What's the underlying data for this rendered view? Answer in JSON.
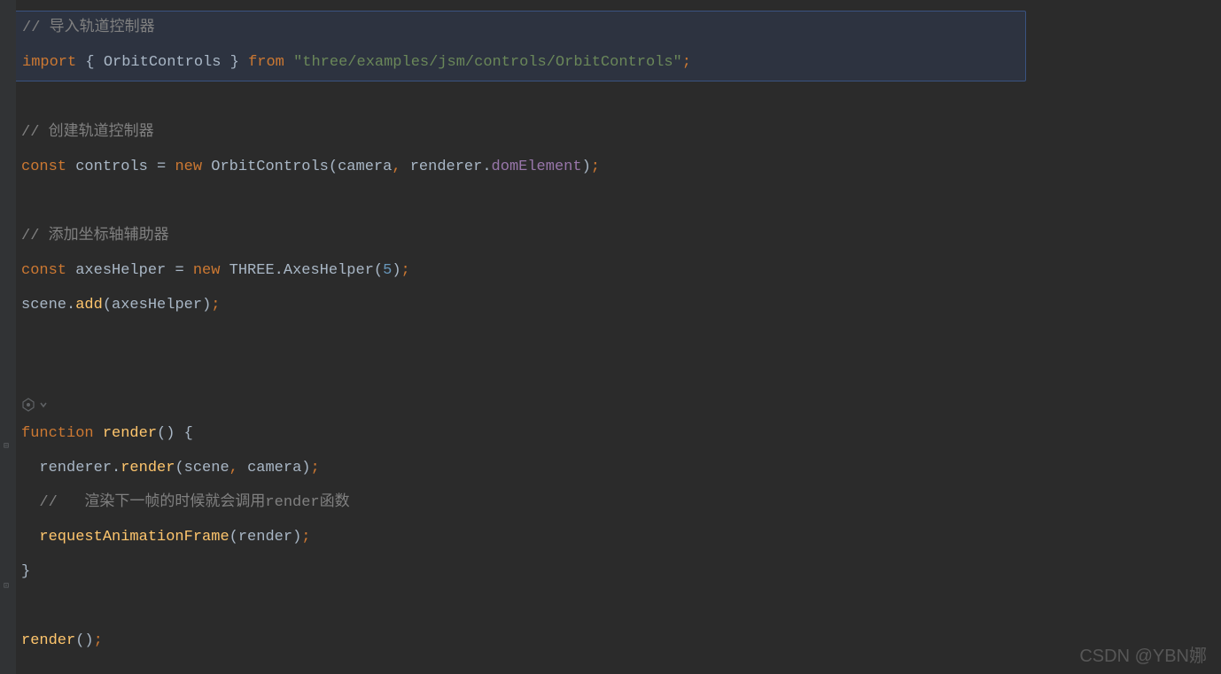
{
  "code": {
    "line1": {
      "comment": "// 导入轨道控制器"
    },
    "line2": {
      "import": "import",
      "brace_open": " { ",
      "orbit": "OrbitControls",
      "brace_close": " } ",
      "from": "from",
      "space": " ",
      "string": "\"three/examples/jsm/controls/OrbitControls\"",
      "semi": ";"
    },
    "line4": {
      "comment": "// 创建轨道控制器"
    },
    "line5": {
      "const": "const ",
      "var": "controls ",
      "eq": "= ",
      "new": "new ",
      "ctor": "OrbitControls",
      "paren_open": "(",
      "arg1": "camera",
      "comma": ", ",
      "arg2": "renderer",
      "dot": ".",
      "prop": "domElement",
      "paren_close": ")",
      "semi": ";"
    },
    "line7": {
      "comment": "// 添加坐标轴辅助器"
    },
    "line8": {
      "const": "const ",
      "var": "axesHelper ",
      "eq": "= ",
      "new": "new ",
      "three": "THREE",
      "dot": ".",
      "ctor": "AxesHelper",
      "paren_open": "(",
      "num": "5",
      "paren_close": ")",
      "semi": ";"
    },
    "line9": {
      "obj": "scene",
      "dot": ".",
      "method": "add",
      "paren_open": "(",
      "arg": "axesHelper",
      "paren_close": ")",
      "semi": ";"
    },
    "line12": {
      "func": "function ",
      "name": "render",
      "parens": "() ",
      "brace": "{"
    },
    "line13": {
      "indent": "  ",
      "obj": "renderer",
      "dot": ".",
      "method": "render",
      "paren_open": "(",
      "arg1": "scene",
      "comma": ", ",
      "arg2": "camera",
      "paren_close": ")",
      "semi": ";"
    },
    "line14": {
      "indent": "  ",
      "comment": "//   渲染下一帧的时候就会调用render函数"
    },
    "line15": {
      "indent": "  ",
      "method": "requestAnimationFrame",
      "paren_open": "(",
      "arg": "render",
      "paren_close": ")",
      "semi": ";"
    },
    "line16": {
      "brace": "}"
    },
    "line18": {
      "method": "render",
      "parens": "()",
      "semi": ";"
    }
  },
  "watermark": "CSDN @YBN娜"
}
